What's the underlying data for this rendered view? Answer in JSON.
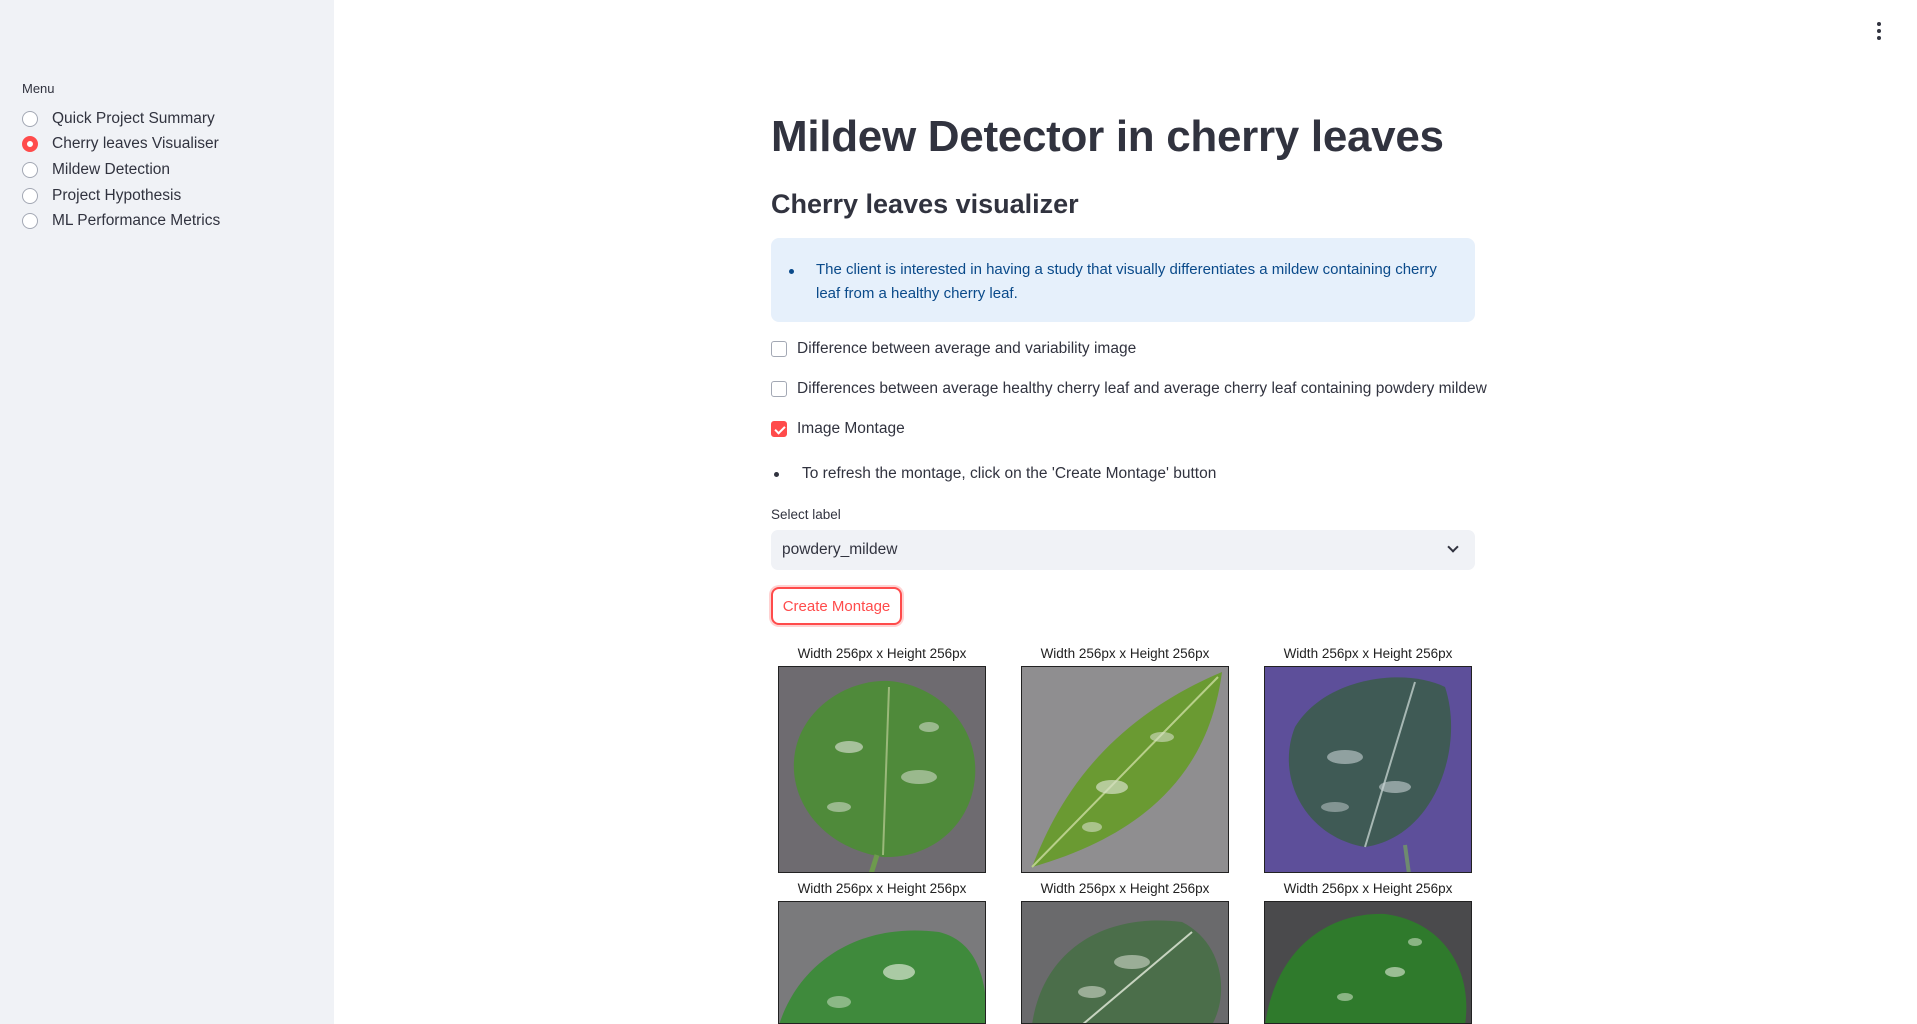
{
  "sidebar": {
    "menu_title": "Menu",
    "items": [
      {
        "label": "Quick Project Summary",
        "selected": false
      },
      {
        "label": "Cherry leaves Visualiser",
        "selected": true
      },
      {
        "label": "Mildew Detection",
        "selected": false
      },
      {
        "label": "Project Hypothesis",
        "selected": false
      },
      {
        "label": "ML Performance Metrics",
        "selected": false
      }
    ]
  },
  "main": {
    "title": "Mildew Detector in cherry leaves",
    "subtitle": "Cherry leaves visualizer",
    "info_text": "The client is interested in having a study that visually differentiates a mildew containing cherry leaf from a healthy cherry leaf.",
    "checkboxes": [
      {
        "label": "Difference between average and variability image",
        "checked": false
      },
      {
        "label": "Differences between average healthy cherry leaf and average cherry leaf containing powdery mildew",
        "checked": false
      },
      {
        "label": "Image Montage",
        "checked": true
      }
    ],
    "refresh_note": "To refresh the montage, click on the 'Create Montage' button",
    "select_label": "Select label",
    "select_value": "powdery_mildew",
    "button_label": "Create Montage",
    "montage_titles": [
      "Width 256px x Height 256px",
      "Width 256px x Height 256px",
      "Width 256px x Height 256px",
      "Width 256px x Height 256px",
      "Width 256px x Height 256px",
      "Width 256px x Height 256px"
    ]
  },
  "colors": {
    "accent": "#ff4b4b",
    "sidebar_bg": "#f0f2f6",
    "info_bg": "#e6f0fb",
    "info_text": "#0a4a8a"
  },
  "icons": {
    "menu": "vertical-ellipsis-icon",
    "select": "chevron-down-icon"
  }
}
